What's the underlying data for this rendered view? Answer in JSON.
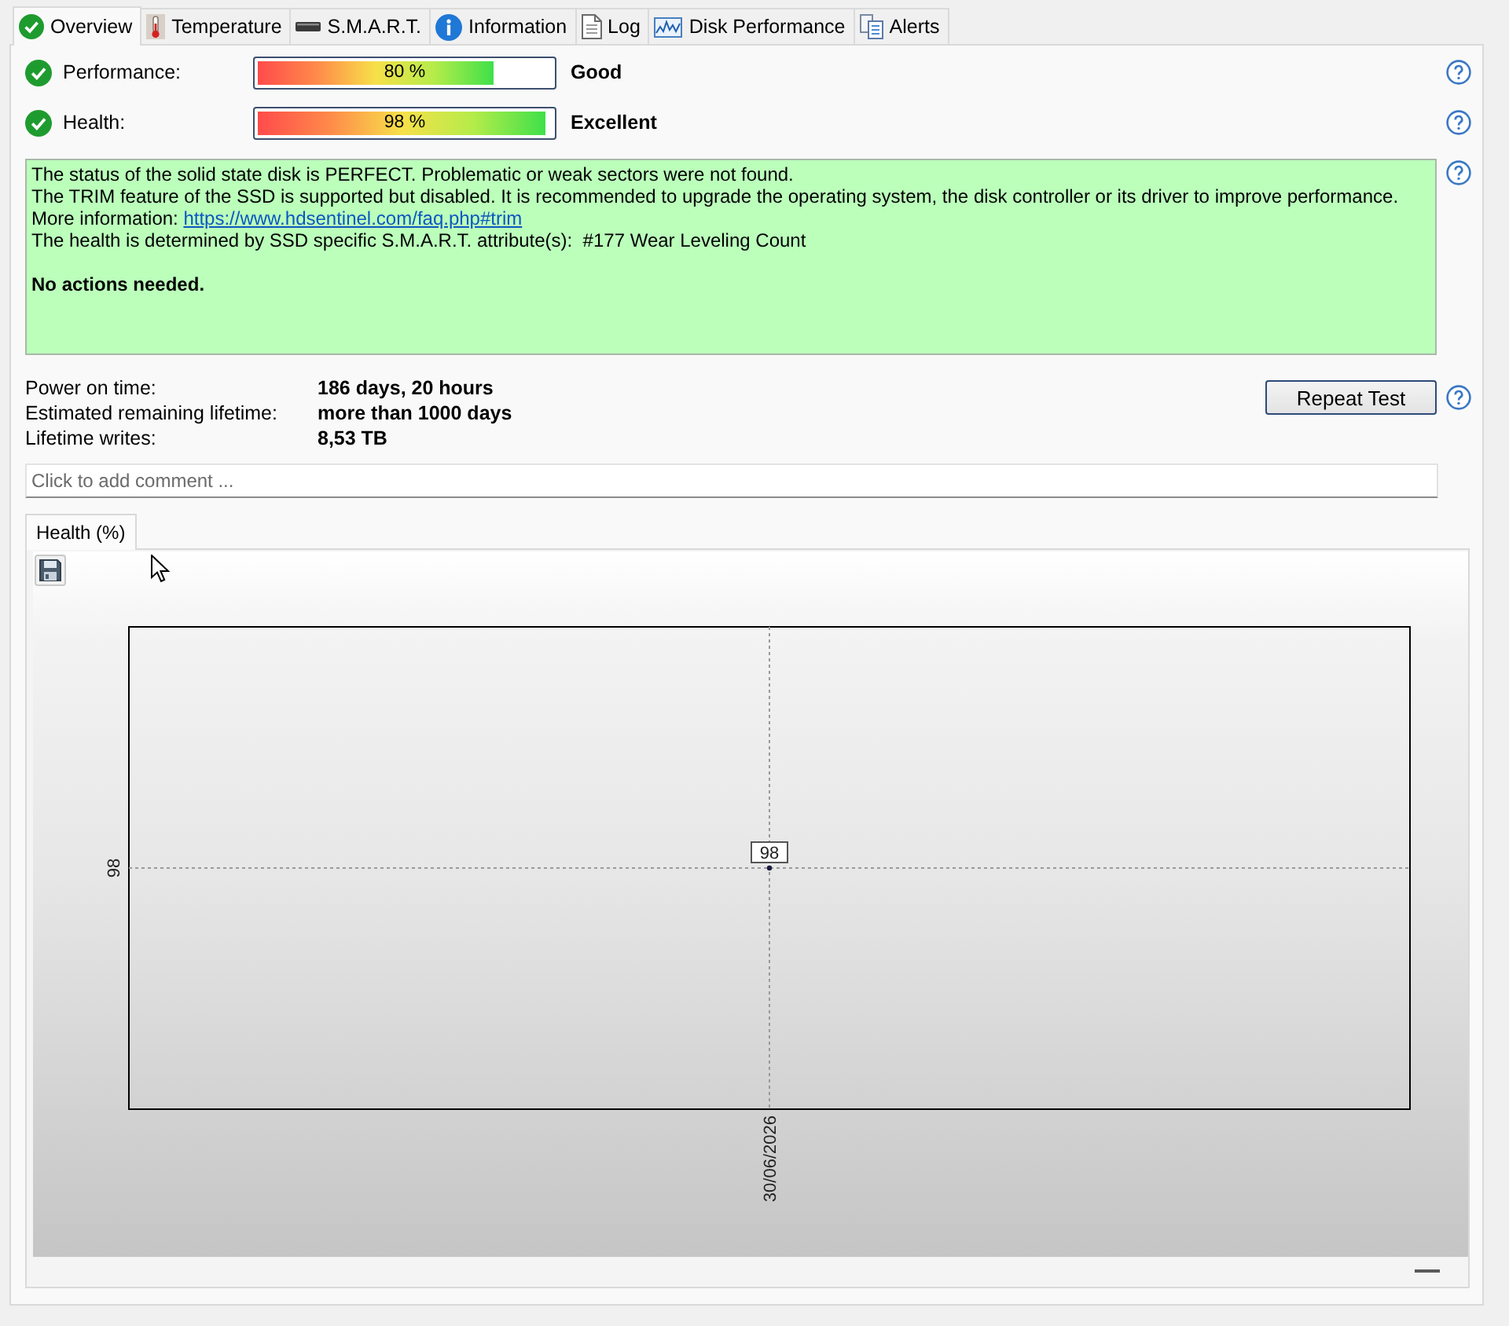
{
  "tabs": [
    {
      "label": "Overview",
      "selected": true
    },
    {
      "label": "Temperature",
      "selected": false
    },
    {
      "label": "S.M.A.R.T.",
      "selected": false
    },
    {
      "label": "Information",
      "selected": false
    },
    {
      "label": "Log",
      "selected": false
    },
    {
      "label": "Disk Performance",
      "selected": false
    },
    {
      "label": "Alerts",
      "selected": false
    }
  ],
  "ratings": [
    {
      "label": "Performance:",
      "level": 0.8,
      "reading": "80 %",
      "verdict": "Good"
    },
    {
      "label": "Health:",
      "level": 0.98,
      "reading": "98 %",
      "verdict": "Excellent"
    }
  ],
  "status_box": {
    "paragraphs": [
      {
        "kind": "text",
        "text": "The status of the solid state disk is PERFECT. Problematic or weak sectors were not found."
      },
      {
        "kind": "text",
        "text": "The TRIM feature of the SSD is supported but disabled. It is recommended to upgrade the operating system, the disk controller or its driver to improve performance."
      },
      {
        "kind": "link",
        "text": "More information:",
        "link": "https://www.hdsentinel.com/faq.php#trim"
      },
      {
        "kind": "text",
        "text": "The health is determined by SSD specific S.M.A.R.T. attribute(s):  #177 Wear Leveling Count"
      },
      {
        "kind": "conclusion",
        "text": "No actions needed."
      }
    ]
  },
  "details": [
    {
      "label": "Power on time:",
      "value": "186 days, 20 hours"
    },
    {
      "label": "Estimated remaining lifetime:",
      "value": "more than 1000 days"
    },
    {
      "label": "Lifetime writes:",
      "value": "8,53 TB"
    }
  ],
  "repeat_button": "Repeat Test",
  "comment": {
    "placeholder": "Click to add comment ..."
  },
  "chart_tabs": [
    {
      "label": "Health (%)",
      "selected": true
    }
  ],
  "chart": {
    "y_axis_labels": [
      "98"
    ],
    "x_axis_labels": [
      "30/06/2026"
    ],
    "point_labels": [
      "98"
    ]
  }
}
